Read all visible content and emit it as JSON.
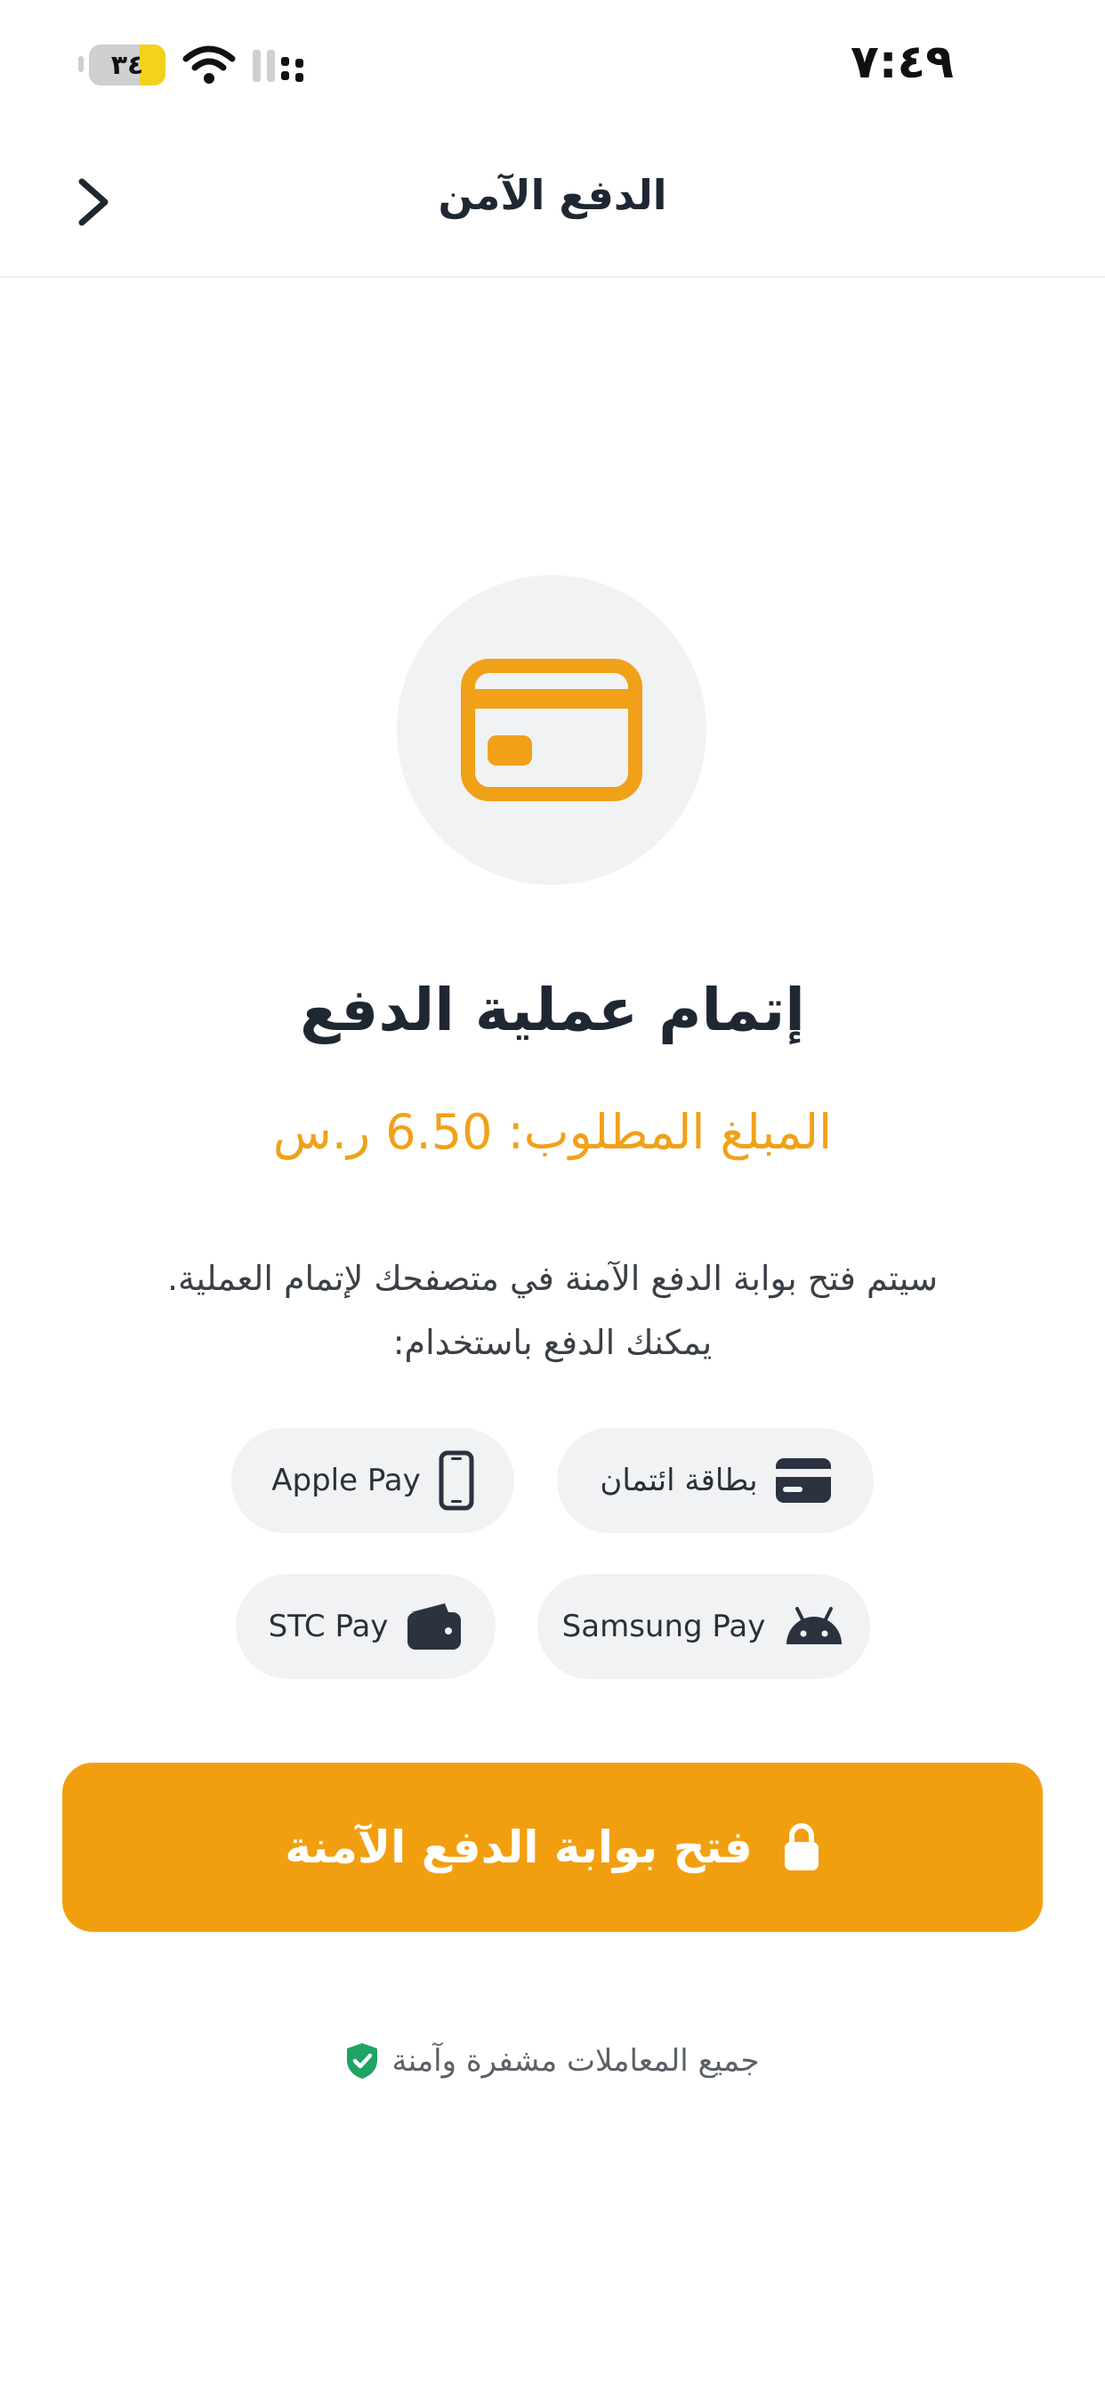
{
  "status_bar": {
    "time": "٧:٤٩",
    "battery": "٣٤",
    "battery_level_percent": 34
  },
  "header": {
    "title": "الدفع الآمن"
  },
  "main": {
    "title": "إتمام عملية الدفع",
    "amount": "المبلغ المطلوب: 6.50 ر.س",
    "description_line1": "سيتم فتح بوابة الدفع الآمنة في متصفحك لإتمام العملية.",
    "description_line2": "يمكنك الدفع باستخدام:"
  },
  "payment_methods": [
    {
      "label": "بطاقة ائتمان",
      "icon": "credit-card-icon"
    },
    {
      "label": "Apple Pay",
      "icon": "phone-icon"
    },
    {
      "label": "Samsung Pay",
      "icon": "android-icon"
    },
    {
      "label": "STC Pay",
      "icon": "wallet-icon"
    }
  ],
  "cta": {
    "label": "فتح بوابة الدفع الآمنة",
    "icon": "lock-icon"
  },
  "footer": {
    "note": "جميع المعاملات مشفرة وآمنة",
    "icon": "shield-check-icon"
  },
  "colors": {
    "accent": "#f29f0f",
    "amount_text": "#f0a118",
    "chip_bg": "#f1f2f4",
    "shield_green": "#1fa463"
  }
}
